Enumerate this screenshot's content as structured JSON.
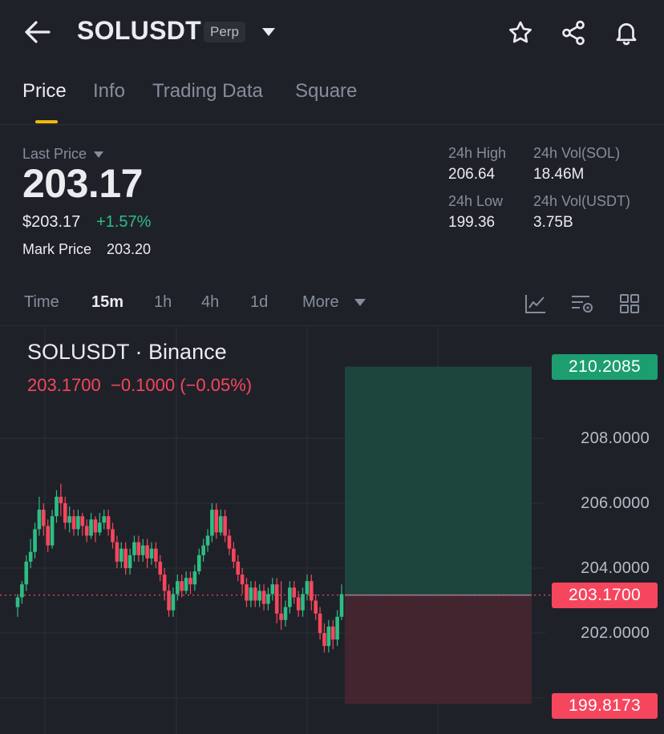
{
  "header": {
    "symbol": "SOLUSDT",
    "badge": "Perp"
  },
  "tabs": [
    "Price",
    "Info",
    "Trading Data",
    "Square"
  ],
  "ticker": {
    "last_price_label": "Last Price",
    "last_price": "203.17",
    "usd_price": "$203.17",
    "change_pct": "+1.57%",
    "mark_price_label": "Mark Price",
    "mark_price": "203.20",
    "high_label": "24h High",
    "high_value": "206.64",
    "low_label": "24h Low",
    "low_value": "199.36",
    "vol_sol_label": "24h Vol(SOL)",
    "vol_sol_value": "18.46M",
    "vol_usdt_label": "24h Vol(USDT)",
    "vol_usdt_value": "3.75B"
  },
  "intervals": {
    "time": "Time",
    "m15": "15m",
    "h1": "1h",
    "h4": "4h",
    "d1": "1d",
    "more": "More"
  },
  "chart": {
    "title": "SOLUSDT · Binance",
    "ohlc_line": "203.1700  −0.1000 (−0.05%)",
    "axis_labels": [
      "208.0000",
      "206.0000",
      "204.0000",
      "202.0000"
    ],
    "take_profit_tag": "210.2085",
    "current_tag": "203.1700",
    "stop_loss_tag": "199.8173",
    "colors": {
      "up": "#2ebd85",
      "down": "#f6465d",
      "accent": "#f0b90b"
    }
  },
  "chart_data": {
    "type": "candlestick",
    "title": "SOLUSDT · Binance",
    "y_ticks": [
      208,
      206,
      204,
      202
    ],
    "current_price": 203.17,
    "take_profit": 210.2085,
    "stop_loss": 199.8173,
    "candles": [
      [
        202.8,
        203.1,
        202.5,
        203.2
      ],
      [
        203.1,
        203.5,
        202.9,
        203.6
      ],
      [
        203.5,
        204.2,
        203.3,
        204.4
      ],
      [
        204.2,
        204.5,
        204.0,
        204.9
      ],
      [
        204.5,
        205.2,
        204.3,
        205.4
      ],
      [
        205.2,
        205.8,
        205.0,
        206.2
      ],
      [
        205.8,
        205.3,
        205.0,
        206.0
      ],
      [
        205.3,
        204.7,
        204.5,
        205.5
      ],
      [
        204.7,
        205.6,
        204.6,
        205.8
      ],
      [
        205.6,
        206.2,
        205.4,
        206.4
      ],
      [
        206.2,
        206.0,
        205.6,
        206.6
      ],
      [
        206.0,
        205.4,
        205.2,
        206.2
      ],
      [
        205.4,
        205.6,
        205.1,
        205.9
      ],
      [
        205.6,
        205.2,
        205.0,
        205.8
      ],
      [
        205.2,
        205.6,
        205.0,
        205.8
      ],
      [
        205.6,
        205.3,
        205.0,
        205.7
      ],
      [
        205.3,
        205.0,
        204.8,
        205.5
      ],
      [
        205.0,
        205.5,
        204.9,
        205.7
      ],
      [
        205.5,
        205.1,
        204.8,
        205.6
      ],
      [
        205.1,
        205.4,
        205.0,
        205.7
      ],
      [
        205.4,
        205.6,
        205.2,
        205.8
      ],
      [
        205.6,
        205.2,
        205.0,
        205.8
      ],
      [
        205.2,
        204.8,
        204.6,
        205.4
      ],
      [
        204.8,
        204.2,
        204.0,
        205.0
      ],
      [
        204.2,
        204.6,
        204.0,
        204.8
      ],
      [
        204.6,
        204.0,
        203.8,
        204.8
      ],
      [
        204.0,
        204.4,
        203.8,
        204.6
      ],
      [
        204.4,
        204.8,
        204.2,
        205.0
      ],
      [
        204.8,
        204.4,
        204.2,
        205.0
      ],
      [
        204.4,
        204.7,
        204.2,
        204.9
      ],
      [
        204.7,
        204.3,
        204.0,
        204.9
      ],
      [
        204.3,
        204.6,
        204.1,
        204.8
      ],
      [
        204.6,
        204.2,
        204.0,
        204.8
      ],
      [
        204.2,
        203.8,
        203.6,
        204.4
      ],
      [
        203.8,
        203.3,
        203.0,
        204.0
      ],
      [
        203.3,
        202.7,
        202.5,
        203.5
      ],
      [
        202.7,
        203.2,
        202.5,
        203.4
      ],
      [
        203.2,
        203.6,
        203.0,
        203.8
      ],
      [
        203.6,
        203.3,
        203.1,
        203.8
      ],
      [
        203.3,
        203.7,
        203.2,
        203.9
      ],
      [
        203.7,
        203.5,
        203.2,
        203.9
      ],
      [
        203.5,
        203.9,
        203.3,
        204.1
      ],
      [
        203.9,
        204.4,
        203.8,
        204.6
      ],
      [
        204.4,
        204.7,
        204.2,
        204.9
      ],
      [
        204.7,
        205.0,
        204.5,
        205.2
      ],
      [
        205.0,
        205.8,
        204.8,
        206.0
      ],
      [
        205.8,
        205.1,
        204.9,
        206.0
      ],
      [
        205.1,
        205.6,
        205.0,
        205.8
      ],
      [
        205.6,
        205.0,
        204.8,
        205.8
      ],
      [
        205.0,
        204.6,
        204.4,
        205.2
      ],
      [
        204.6,
        204.2,
        204.0,
        204.8
      ],
      [
        204.2,
        203.8,
        203.6,
        204.4
      ],
      [
        203.8,
        203.5,
        203.2,
        204.0
      ],
      [
        203.5,
        203.0,
        202.8,
        203.7
      ],
      [
        203.0,
        203.4,
        202.8,
        203.6
      ],
      [
        203.4,
        203.0,
        202.8,
        203.6
      ],
      [
        203.0,
        203.3,
        202.8,
        203.5
      ],
      [
        203.3,
        202.9,
        202.7,
        203.5
      ],
      [
        202.9,
        203.2,
        202.7,
        203.4
      ],
      [
        203.2,
        203.5,
        203.0,
        203.7
      ],
      [
        203.5,
        202.6,
        202.3,
        203.7
      ],
      [
        202.6,
        202.4,
        202.1,
        203.6
      ],
      [
        202.4,
        202.8,
        202.2,
        203.0
      ],
      [
        202.8,
        203.4,
        202.6,
        203.6
      ],
      [
        203.4,
        203.1,
        202.9,
        203.6
      ],
      [
        203.1,
        202.7,
        202.5,
        203.3
      ],
      [
        202.7,
        203.2,
        202.5,
        203.4
      ],
      [
        203.2,
        203.6,
        203.0,
        203.8
      ],
      [
        203.6,
        203.0,
        202.7,
        203.8
      ],
      [
        203.0,
        202.6,
        202.4,
        203.2
      ],
      [
        202.6,
        202.0,
        201.8,
        202.8
      ],
      [
        202.0,
        201.6,
        201.4,
        202.3
      ],
      [
        201.6,
        202.2,
        201.4,
        202.4
      ],
      [
        202.2,
        201.8,
        201.5,
        202.4
      ],
      [
        201.8,
        202.5,
        201.6,
        202.7
      ],
      [
        202.5,
        203.2,
        202.4,
        203.5
      ]
    ]
  }
}
